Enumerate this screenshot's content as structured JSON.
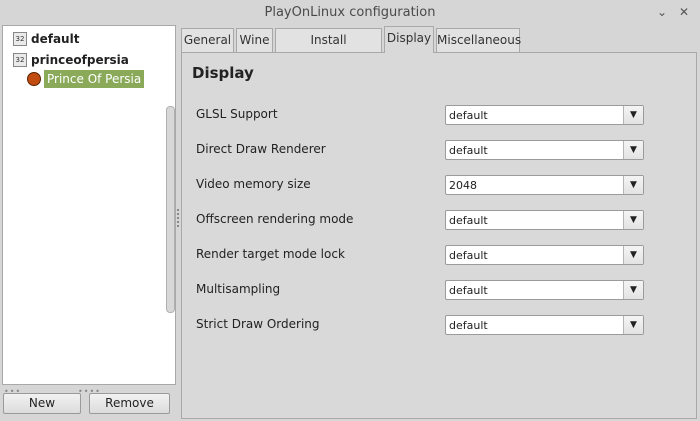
{
  "window": {
    "title": "PlayOnLinux configuration",
    "minimize_icon": "⌄",
    "close_icon": "✕"
  },
  "sidebar": {
    "items": [
      {
        "icon_text": "32",
        "label": "default"
      },
      {
        "icon_text": "32",
        "label": "princeofpersia"
      }
    ],
    "child": {
      "label": "Prince Of Persia"
    }
  },
  "buttons": {
    "new_label": "New",
    "remove_label": "Remove"
  },
  "tabs": [
    {
      "label": "General"
    },
    {
      "label": "Wine"
    },
    {
      "label": "Install components"
    },
    {
      "label": "Display",
      "active": true
    },
    {
      "label": "Miscellaneous"
    }
  ],
  "panel": {
    "title": "Display",
    "rows": [
      {
        "label": "GLSL Support",
        "value": "default"
      },
      {
        "label": "Direct Draw Renderer",
        "value": "default"
      },
      {
        "label": "Video memory size",
        "value": "2048"
      },
      {
        "label": "Offscreen rendering mode",
        "value": "default"
      },
      {
        "label": "Render target mode lock",
        "value": "default"
      },
      {
        "label": "Multisampling",
        "value": "default"
      },
      {
        "label": "Strict Draw Ordering",
        "value": "default"
      }
    ],
    "dropdown_arrow": "▼"
  },
  "colors": {
    "selection": "#8aaa5a",
    "background": "#d6d6d6"
  }
}
